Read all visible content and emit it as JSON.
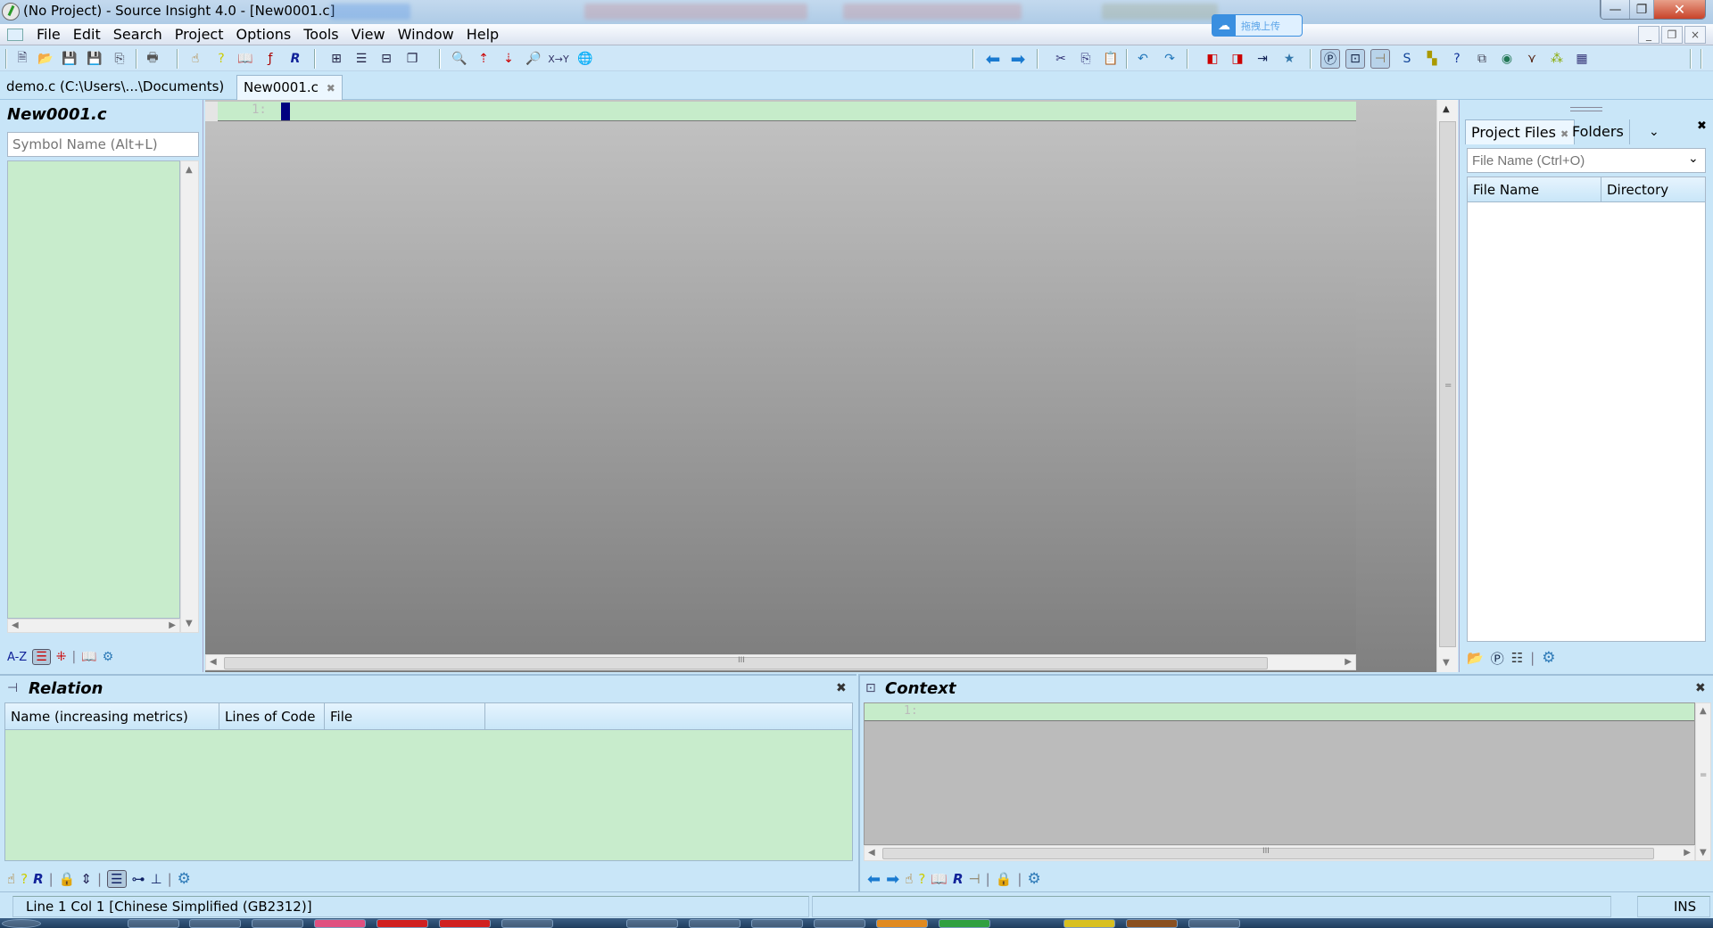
{
  "window": {
    "title": "(No Project) - Source Insight 4.0 - [New0001.c]",
    "min_label": "—",
    "max_label": "❐",
    "close_label": "✕"
  },
  "upload_widget": {
    "icon": "cloud-icon",
    "label": "拖拽上传"
  },
  "menu": {
    "items": [
      "File",
      "Edit",
      "Search",
      "Project",
      "Options",
      "Tools",
      "View",
      "Window",
      "Help"
    ],
    "mdi_min": "_",
    "mdi_restore": "❐",
    "mdi_close": "×"
  },
  "toolbar": {
    "icons": [
      "new-file-icon",
      "open-folder-icon",
      "save-icon",
      "save-as-icon",
      "save-all-icon",
      "print-icon",
      "jump-to-definition-icon",
      "lookup-references-icon",
      "browse-symbol-icon",
      "function-call-icon",
      "r-icon",
      "layout-split-icon",
      "layout-single-icon",
      "layout-horizontal-icon",
      "layout-cascade-icon",
      "search-icon",
      "search-backward-icon",
      "search-forward-icon",
      "search-files-icon",
      "replace-xy-icon",
      "web-icon",
      "back-icon",
      "forward-icon",
      "cut-icon",
      "copy-icon",
      "paste-icon",
      "undo-icon",
      "redo-icon",
      "bookmark-prev-icon",
      "bookmark-next-icon",
      "indent-icon",
      "bookmark-icon",
      "project-icon",
      "symbol-window-icon",
      "relation-window-icon",
      "script-icon",
      "class-icon",
      "help-icon",
      "windows-icon",
      "browser-icon",
      "eagle-icon",
      "merge-icon",
      "grid-icon"
    ]
  },
  "file_tabs": [
    {
      "label": "demo.c (C:\\Users\\...\\Documents)",
      "active": false
    },
    {
      "label": "New0001.c",
      "active": true,
      "close": "✖"
    }
  ],
  "symbol_panel": {
    "title": "New0001.c",
    "search_placeholder": "Symbol Name (Alt+L)",
    "tools": {
      "az": "A-Z"
    }
  },
  "editor": {
    "line_number": "1:",
    "hscroll_grip": "III",
    "vscroll_grip": "="
  },
  "project_panel": {
    "tabs": [
      {
        "label": "Project Files",
        "active": true,
        "close": "✖"
      },
      {
        "label": "Folders",
        "active": false
      }
    ],
    "dropdown": "⌄",
    "close": "✖",
    "search_placeholder": "File Name (Ctrl+O)",
    "columns": [
      "File Name",
      "Directory"
    ]
  },
  "relation_panel": {
    "title": "Relation",
    "close": "✖",
    "columns": [
      "Name (increasing metrics)",
      "Lines of Code",
      "File",
      ""
    ]
  },
  "context_panel": {
    "title": "Context",
    "close": "✖",
    "line_number": "1:"
  },
  "status_bar": {
    "position": "Line 1  Col 1   [Chinese Simplified (GB2312)]",
    "mode": "INS"
  }
}
